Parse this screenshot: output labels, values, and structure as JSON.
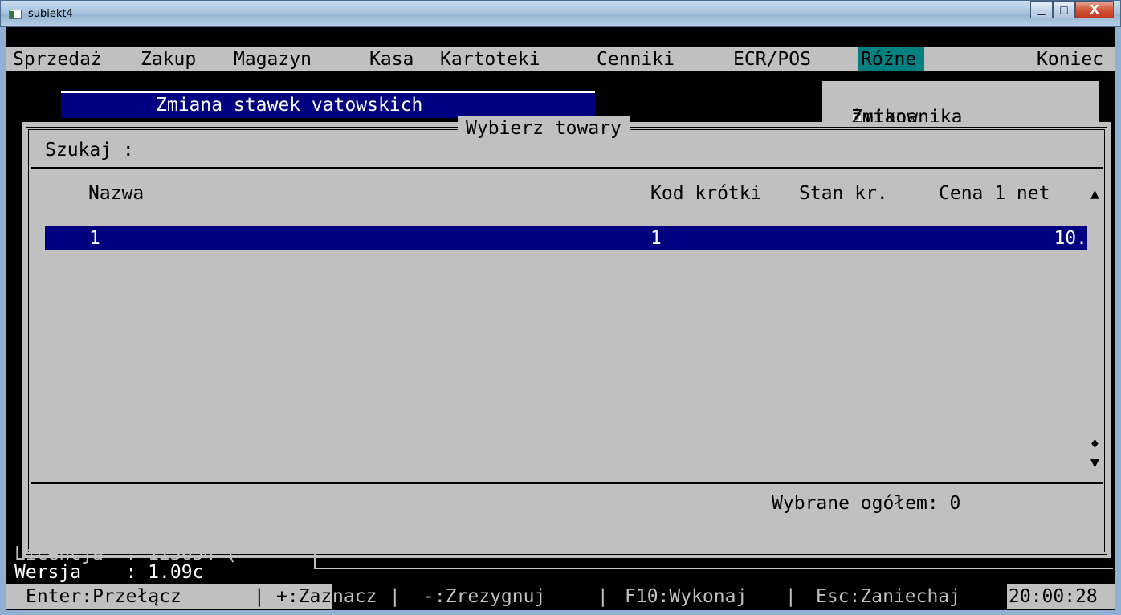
{
  "window": {
    "title": "subiekt4",
    "minimize_glyph": "▁",
    "maximize_glyph": "□",
    "close_glyph": "X"
  },
  "menu": {
    "items": [
      "Sprzedaż",
      "Zakup",
      "Magazyn",
      "Kasa",
      "Kartoteki",
      "Cenniki",
      "ECR/POS",
      "Różne",
      "Koniec"
    ],
    "active": "Różne"
  },
  "submenu": {
    "title": "Zmiana stawek vatowskich",
    "user_change_prefix": "Zmiana ",
    "user_change_hotkey": "u",
    "user_change_suffix": "żytkownika"
  },
  "dialog": {
    "title": "Wybierz towary",
    "search_label": "Szukaj :",
    "columns": {
      "name": "Nazwa",
      "short_code": "Kod krótki",
      "stock": "Stan kr.",
      "price": "Cena 1 net"
    },
    "rows": [
      {
        "name": "1",
        "short_code": "1",
        "stock": "",
        "price": "10."
      }
    ],
    "scroll_up": "▲",
    "scroll_thumb": "♦",
    "scroll_down": "▼",
    "summary": "Wybrane ogółem: 0"
  },
  "status": {
    "license_label": "Licencja",
    "license_value": ": 123654 (",
    "version_label": "Wersja",
    "version_value": ": 1.09c"
  },
  "fkeys": {
    "enter": "Enter:Przełącz",
    "sep1": " | ",
    "plus_a": "+:Zaz",
    "plus_b": "nacz",
    "sep2": " | ",
    "minus": "-:Zrezygnuj",
    "sep3": " | ",
    "f10": "F10:Wykonaj",
    "sep4": " | ",
    "esc": "Esc:Zaniechaj",
    "clock": "20:00:28"
  }
}
